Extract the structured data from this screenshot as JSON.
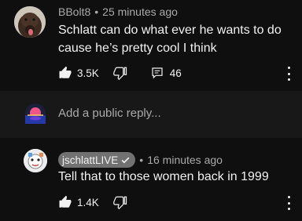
{
  "comments": [
    {
      "author": "BBolt8",
      "time": "25 minutes ago",
      "text": "Schlatt can do what ever he wants to do cause he’s pretty cool I think",
      "likes": "3.5K",
      "replies": "46"
    },
    {
      "author": "jschlattLIVE",
      "time": "16 minutes ago",
      "text": "Tell that to those women back in 1999",
      "likes": "1.4K"
    }
  ],
  "reply_box": {
    "placeholder": "Add a public reply..."
  },
  "separator": "•",
  "colors": {
    "background": "#0f0f0f",
    "reply_box_bg": "#181818",
    "secondary_text": "#aaaaaa",
    "creator_badge": "#717171"
  },
  "icons": [
    "thumbs-up-icon",
    "thumbs-down-icon",
    "comment-icon",
    "more-vert-icon",
    "verified-check-icon"
  ]
}
